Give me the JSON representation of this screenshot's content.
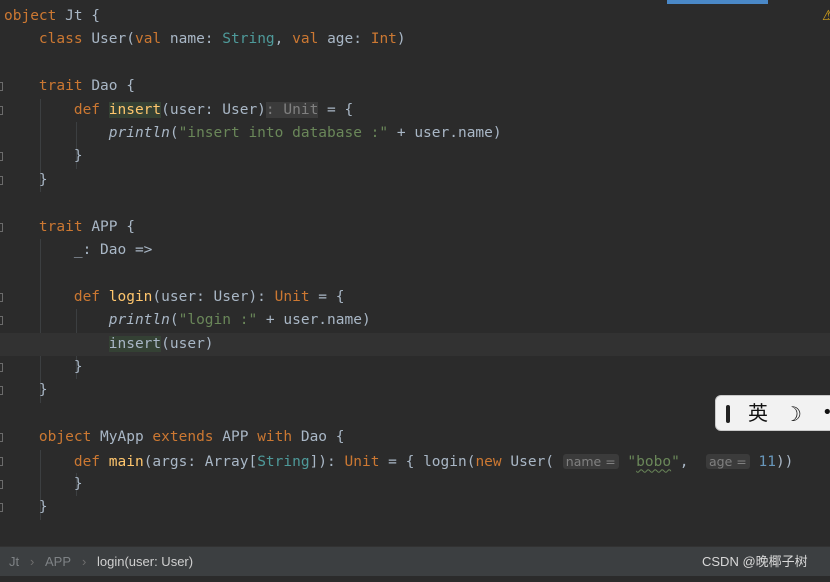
{
  "editor": {
    "lines": [
      {
        "tokens": [
          {
            "t": "object ",
            "c": "kw"
          },
          {
            "t": "Jt {"
          }
        ]
      },
      {
        "tokens": [
          {
            "t": "    "
          },
          {
            "t": "class ",
            "c": "kw"
          },
          {
            "t": "User("
          },
          {
            "t": "val ",
            "c": "kw"
          },
          {
            "t": "name: "
          },
          {
            "t": "String",
            "c": "typ"
          },
          {
            "t": ", "
          },
          {
            "t": "val ",
            "c": "kw"
          },
          {
            "t": "age: "
          },
          {
            "t": "Int",
            "c": "kw"
          },
          {
            "t": ")"
          }
        ]
      },
      {
        "tokens": []
      },
      {
        "tokens": [
          {
            "t": "    "
          },
          {
            "t": "trait ",
            "c": "kw"
          },
          {
            "t": "Dao {"
          }
        ]
      },
      {
        "tokens": [
          {
            "t": "        "
          },
          {
            "t": "def ",
            "c": "kw"
          },
          {
            "t": "insert",
            "c": "hl-def"
          },
          {
            "t": "(user: User)"
          },
          {
            "t": ": Unit",
            "c": "hint-inline"
          },
          {
            "t": " = {"
          }
        ]
      },
      {
        "tokens": [
          {
            "t": "            "
          },
          {
            "t": "println",
            "c": "ital"
          },
          {
            "t": "("
          },
          {
            "t": "\"insert into database :\"",
            "c": "str"
          },
          {
            "t": " + user.name)"
          }
        ]
      },
      {
        "tokens": [
          {
            "t": "        }"
          }
        ]
      },
      {
        "tokens": [
          {
            "t": "    }"
          }
        ]
      },
      {
        "tokens": []
      },
      {
        "tokens": [
          {
            "t": "    "
          },
          {
            "t": "trait ",
            "c": "kw"
          },
          {
            "t": "APP {"
          }
        ]
      },
      {
        "tokens": [
          {
            "t": "        _: Dao =>"
          }
        ]
      },
      {
        "tokens": []
      },
      {
        "tokens": [
          {
            "t": "        "
          },
          {
            "t": "def ",
            "c": "kw"
          },
          {
            "t": "login",
            "c": "fn"
          },
          {
            "t": "(user: User): "
          },
          {
            "t": "Unit",
            "c": "kw"
          },
          {
            "t": " = {"
          }
        ]
      },
      {
        "tokens": [
          {
            "t": "            "
          },
          {
            "t": "println",
            "c": "ital"
          },
          {
            "t": "("
          },
          {
            "t": "\"login :\"",
            "c": "str"
          },
          {
            "t": " + user.name)"
          }
        ]
      },
      {
        "tokens": [
          {
            "t": "            "
          },
          {
            "t": "insert",
            "c": "hl-green"
          },
          {
            "t": "(user)"
          }
        ]
      },
      {
        "tokens": [
          {
            "t": "        }"
          }
        ]
      },
      {
        "tokens": [
          {
            "t": "    }"
          }
        ]
      },
      {
        "tokens": []
      },
      {
        "tokens": [
          {
            "t": "    "
          },
          {
            "t": "object ",
            "c": "kw"
          },
          {
            "t": "MyApp "
          },
          {
            "t": "extends ",
            "c": "kw"
          },
          {
            "t": "APP "
          },
          {
            "t": "with ",
            "c": "kw"
          },
          {
            "t": "Dao {"
          }
        ]
      },
      {
        "tokens": [
          {
            "t": "        "
          },
          {
            "t": "def ",
            "c": "kw"
          },
          {
            "t": "main",
            "c": "fn"
          },
          {
            "t": "(args: Array["
          },
          {
            "t": "String",
            "c": "typ"
          },
          {
            "t": "]): "
          },
          {
            "t": "Unit",
            "c": "kw"
          },
          {
            "t": " = { login("
          },
          {
            "t": "new ",
            "c": "kw"
          },
          {
            "t": "User( "
          },
          {
            "t": "name =",
            "c": "hint"
          },
          {
            "t": " "
          },
          {
            "t": "\"",
            "c": "str"
          },
          {
            "t": "bobo",
            "c": "str-wavy"
          },
          {
            "t": "\"",
            "c": "str"
          },
          {
            "t": ",  "
          },
          {
            "t": "age =",
            "c": "hint"
          },
          {
            "t": " "
          },
          {
            "t": "11",
            "c": "num"
          },
          {
            "t": "))"
          }
        ]
      },
      {
        "tokens": [
          {
            "t": "        }"
          }
        ]
      },
      {
        "tokens": [
          {
            "t": "    }"
          }
        ]
      }
    ]
  },
  "breadcrumb": {
    "items": [
      "Jt",
      "APP",
      "login(user: User)"
    ]
  },
  "ime": {
    "language": "英",
    "moon": "☽",
    "dot": "•"
  },
  "watermark": "CSDN @晚椰子树",
  "colors": {
    "background": "#2b2b2b",
    "keyword": "#cc7832",
    "string": "#6a8759",
    "type": "#4e9a9a",
    "text": "#a9b7c6",
    "number": "#6897bb",
    "function": "#ffc66d"
  }
}
